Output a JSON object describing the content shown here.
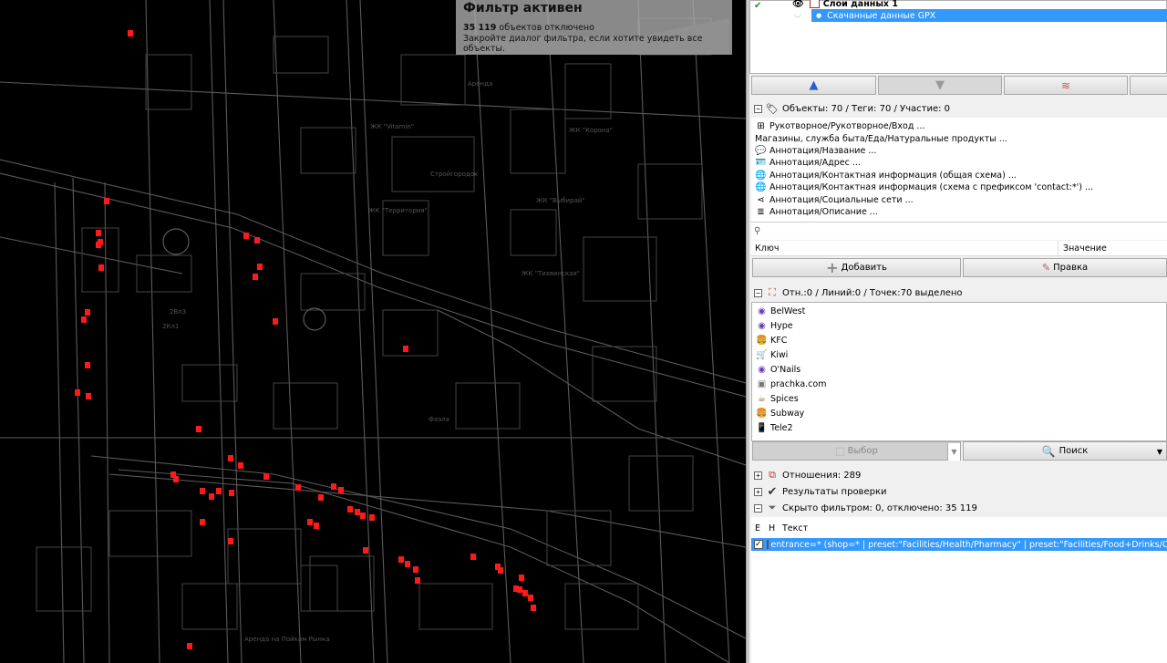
{
  "map": {
    "labels": [
      "ЖК \"Vitamin\"",
      "ЖК \"Корона\"",
      "Стройгородок",
      "ЖК \"Территория\"",
      "ЖК \"Выбирай\"",
      "ЖК \"Тихвинская\"",
      "2Вл3",
      "2Кл1",
      "Фаэла",
      "Аренда",
      "Аренда на Пойкам Рынка"
    ],
    "marker_color": "#ff1a1a",
    "line_color": "#5a5a5a"
  },
  "filter_overlay": {
    "title": "Фильтр активен",
    "count": "35 119",
    "count_suffix": " объектов отключено",
    "hint": "Закройте диалог фильтра, если хотите увидеть все объекты."
  },
  "layers": {
    "items": [
      {
        "label": "Слои данных 1",
        "selected": false
      },
      {
        "label": "Скачанные данные GPX",
        "selected": true
      }
    ]
  },
  "tags": {
    "header": "Объекты: 70 / Теги: 70 / Участие: 0",
    "presets": [
      {
        "icon": "door-icon",
        "label": "Рукотворное/Рукотворное/Вход ..."
      },
      {
        "icon": "",
        "label": "Магазины, служба быта/Еда/Натуральные продукты ..."
      },
      {
        "icon": "speech-bubble-icon",
        "label": "Аннотация/Название ..."
      },
      {
        "icon": "address-card-icon",
        "label": "Аннотация/Адрес ..."
      },
      {
        "icon": "globe-icon",
        "label": "Аннотация/Контактная информация (общая схема) ..."
      },
      {
        "icon": "globe-icon",
        "label": "Аннотация/Контактная информация (схема с префиксом 'contact:*') ..."
      },
      {
        "icon": "share-icon",
        "label": "Аннотация/Социальные сети ..."
      },
      {
        "icon": "notes-icon",
        "label": "Аннотация/Описание ..."
      }
    ],
    "search_placeholder": "",
    "col_key": "Ключ",
    "col_value": "Значение",
    "add_label": "Добавить",
    "edit_label": "Правка"
  },
  "selection": {
    "header": "Отн.:0 / Линий:0 / Точек:70 выделено",
    "items": [
      {
        "icon": "eye-icon",
        "label": "BelWest"
      },
      {
        "icon": "eye-icon",
        "label": "Hype"
      },
      {
        "icon": "fastfood-icon",
        "label": "KFC"
      },
      {
        "icon": "grocery-icon",
        "label": "Kiwi"
      },
      {
        "icon": "eye-icon",
        "label": "O'Nails"
      },
      {
        "icon": "laundry-icon",
        "label": "prachka.com"
      },
      {
        "icon": "cup-icon",
        "label": "Spices"
      },
      {
        "icon": "fastfood-icon",
        "label": "Subway"
      },
      {
        "icon": "phone-icon",
        "label": "Tele2"
      }
    ],
    "select_label": "Выбор",
    "search_label": "Поиск"
  },
  "relations": {
    "header": "Отношения: 289"
  },
  "validation": {
    "header": "Результаты проверки"
  },
  "filters": {
    "header": "Скрыто фильтром: 0, отключено: 35 119",
    "col_e": "E",
    "col_h": "H",
    "col_text": "Текст",
    "rows": [
      {
        "enabled": true,
        "hidden": false,
        "text": "entrance=* (shop=* | preset:\"Facilities/Health/Pharmacy\" | preset:\"Facilities/Food+Drinks/Cafe\""
      }
    ]
  },
  "colors": {
    "selection_blue": "#3399ff",
    "panel_bg": "#f0f0f0"
  }
}
